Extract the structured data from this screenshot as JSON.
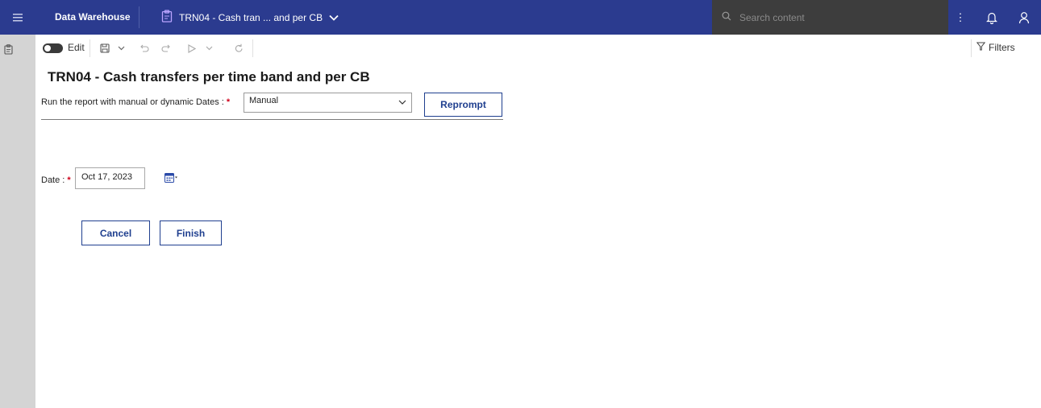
{
  "topbar": {
    "menu_icon": "hamburger-icon",
    "app_name": "Data Warehouse",
    "report_tab_label": "TRN04 - Cash tran ... and per CB",
    "report_tab_icon": "report-clipboard-icon",
    "tab_dropdown_icon": "chevron-down-icon",
    "search_placeholder": "Search content",
    "search_icon": "search-icon",
    "more_icon": "kebab-icon",
    "notifications_icon": "bell-icon",
    "user_icon": "user-icon",
    "bar_color": "#2b3b8f"
  },
  "leftrail": {
    "icon": "report-clipboard-icon"
  },
  "toolbar": {
    "edit_label": "Edit",
    "edit_toggle_on": false,
    "icons": [
      "save-icon",
      "save-dropdown-icon",
      "undo-icon",
      "redo-icon",
      "run-icon",
      "run-dropdown-icon",
      "refresh-icon"
    ],
    "filters_label": "Filters",
    "filters_icon": "filter-icon"
  },
  "prompt": {
    "title": "TRN04 - Cash transfers per time band and per CB",
    "dates_label": "Run the report with manual or dynamic Dates :",
    "required_marker": "*",
    "dates_value": "Manual",
    "reprompt_label": "Reprompt",
    "date_label": "Date :",
    "date_value": "Oct 17, 2023",
    "calendar_icon": "calendar-icon",
    "cancel_label": "Cancel",
    "finish_label": "Finish",
    "accent_color": "#1f3f8f",
    "required_color": "#d0021b"
  }
}
